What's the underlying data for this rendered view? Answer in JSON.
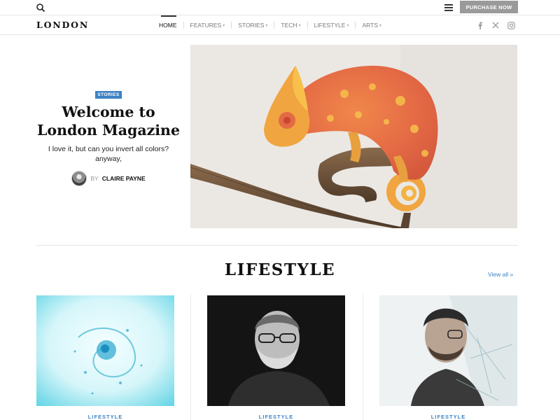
{
  "topbar": {
    "purchase_label": "PURCHASE NOW"
  },
  "header": {
    "logo": "LONDON",
    "nav": [
      {
        "label": "HOME",
        "active": true
      },
      {
        "label": "FEATURES",
        "has_dropdown": true
      },
      {
        "label": "STORIES",
        "has_dropdown": true
      },
      {
        "label": "TECH",
        "has_dropdown": true
      },
      {
        "label": "LIFESTYLE",
        "has_dropdown": true
      },
      {
        "label": "ARTS",
        "has_dropdown": true
      }
    ],
    "socials": [
      "facebook-icon",
      "x-icon",
      "instagram-icon"
    ]
  },
  "hero": {
    "badge": "STORIES",
    "title_line1": "Welcome to",
    "title_line2": "London Magazine",
    "subtitle": "I love it, but can you invert all colors? anyway,",
    "byline_prefix": "BY",
    "author": "CLAIRE PAYNE"
  },
  "section": {
    "title": "LIFESTYLE",
    "view_all": "View all »"
  },
  "cards": [
    {
      "category": "LIFESTYLE"
    },
    {
      "category": "LIFESTYLE"
    },
    {
      "category": "LIFESTYLE"
    }
  ],
  "colors": {
    "accent": "#3d82c4",
    "button_bg": "#9a9a9a"
  }
}
